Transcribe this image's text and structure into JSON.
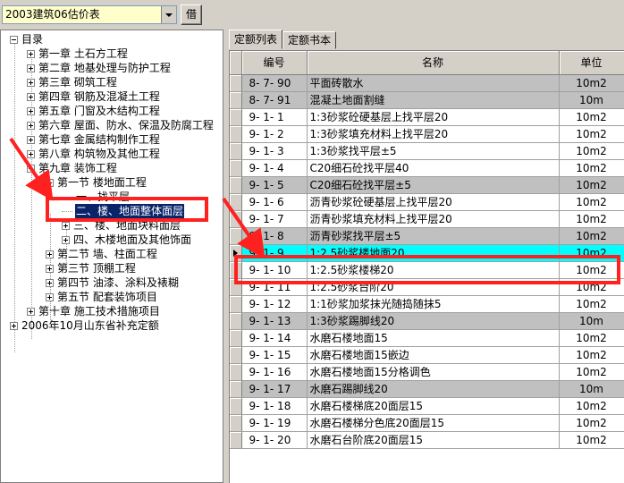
{
  "toolbar": {
    "table_select_value": "2003建筑06估价表",
    "borrow_label": "借"
  },
  "tree": {
    "root": "目录",
    "chapters": [
      "第一章 土石方工程",
      "第二章 地基处理与防护工程",
      "第三章 砌筑工程",
      "第四章 钢筋及混凝土工程",
      "第五章 门窗及木结构工程",
      "第六章 屋面、防水、保温及防腐工程",
      "第七章 金属结构制作工程",
      "第八章 构筑物及其他工程",
      "第九章 装饰工程"
    ],
    "ch9_sec1": "第一节 楼地面工程",
    "sub1": "一、找平层",
    "sub2_selected": "二、楼、地面整体面层",
    "sub3": "三、楼、地面块料面层",
    "sub4": "四、木楼地面及其他饰面",
    "ch9_sections": [
      "第二节 墙、柱面工程",
      "第三节 顶棚工程",
      "第四节 油漆、涂料及裱糊",
      "第五节 配套装饰项目"
    ],
    "ch10": "第十章 施工技术措施项目",
    "supplement": "2006年10月山东省补充定额"
  },
  "tabs": [
    "定额列表",
    "定额书本"
  ],
  "grid": {
    "headers": [
      "编号",
      "名称",
      "单位"
    ],
    "rows": [
      {
        "code": "8- 7- 90",
        "name": "平面砖散水",
        "unit": "10m2",
        "style": "hl"
      },
      {
        "code": "8- 7- 91",
        "name": "混凝土地面割缝",
        "unit": "10m",
        "style": "hl"
      },
      {
        "code": "9- 1- 1",
        "name": "1:3砂浆砼硬基层上找平层20",
        "unit": "10m2",
        "style": ""
      },
      {
        "code": "9- 1- 2",
        "name": "1:3砂浆填充材料上找平层20",
        "unit": "10m2",
        "style": ""
      },
      {
        "code": "9- 1- 3",
        "name": "1:3砂浆找平层±5",
        "unit": "10m2",
        "style": ""
      },
      {
        "code": "9- 1- 4",
        "name": "C20细石砼找平层40",
        "unit": "10m2",
        "style": ""
      },
      {
        "code": "9- 1- 5",
        "name": "C20细石砼找平层±5",
        "unit": "10m2",
        "style": "hl"
      },
      {
        "code": "9- 1- 6",
        "name": "沥青砂浆砼硬基层上找平层20",
        "unit": "10m2",
        "style": ""
      },
      {
        "code": "9- 1- 7",
        "name": "沥青砂浆填充材料上找平层20",
        "unit": "10m2",
        "style": ""
      },
      {
        "code": "9- 1- 8",
        "name": "沥青砂浆找平层±5",
        "unit": "10m2",
        "style": "hl"
      },
      {
        "code": "9- 1- 9",
        "name": "1:2.5砂浆楼地面20",
        "unit": "10m2",
        "style": "cur"
      },
      {
        "code": "9- 1- 10",
        "name": "1:2.5砂浆楼梯20",
        "unit": "10m2",
        "style": ""
      },
      {
        "code": "9- 1- 11",
        "name": "1:2.5砂浆台阶20",
        "unit": "10m2",
        "style": ""
      },
      {
        "code": "9- 1- 12",
        "name": "1:1砂浆加浆抹光随捣随抹5",
        "unit": "10m2",
        "style": ""
      },
      {
        "code": "9- 1- 13",
        "name": "1:3砂浆踢脚线20",
        "unit": "10m",
        "style": "hl"
      },
      {
        "code": "9- 1- 14",
        "name": "水磨石楼地面15",
        "unit": "10m2",
        "style": ""
      },
      {
        "code": "9- 1- 15",
        "name": "水磨石楼地面15嵌边",
        "unit": "10m2",
        "style": ""
      },
      {
        "code": "9- 1- 16",
        "name": "水磨石楼地面15分格调色",
        "unit": "10m2",
        "style": ""
      },
      {
        "code": "9- 1- 17",
        "name": "水磨石踢脚线20",
        "unit": "10m",
        "style": "hl"
      },
      {
        "code": "9- 1- 18",
        "name": "水磨石楼梯底20面层15",
        "unit": "10m2",
        "style": ""
      },
      {
        "code": "9- 1- 19",
        "name": "水磨石楼梯分色底20面层15",
        "unit": "10m2",
        "style": ""
      },
      {
        "code": "9- 1- 20",
        "name": "水磨石台阶底20面层15",
        "unit": "10m2",
        "style": ""
      }
    ]
  },
  "colors": {
    "highlight_row": "#c0c0c0",
    "current_row": "#00ffff",
    "annotation_red": "#ff2020",
    "tree_selection": "#0a246a"
  }
}
